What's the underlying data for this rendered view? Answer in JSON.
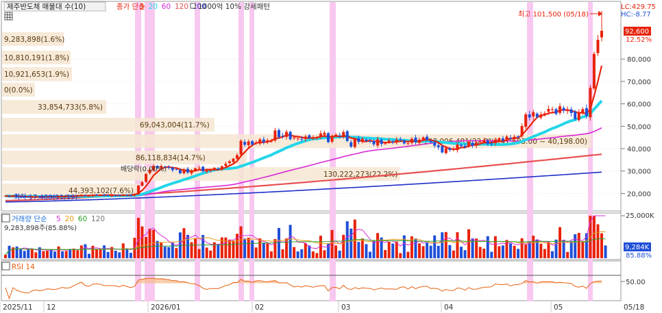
{
  "header": {
    "stock_name": "제주반도체 매물대 수(10)",
    "ma_title": "종가 단순",
    "ma_periods": [
      "5",
      "20",
      "60",
      "120",
      "200"
    ],
    "ma_colors": [
      "#e8220a",
      "#22d6e8",
      "#d82ad8",
      "#e85050",
      "#1f2fc8"
    ],
    "filter_text": "1000억 10% 강세패턴"
  },
  "lc_hc": {
    "lc": "LC:429.75",
    "hc": "HC:-8.77"
  },
  "price_axis": {
    "ticks": [
      "80,000",
      "70,000",
      "60,000",
      "50,000",
      "40,000",
      "30,000",
      "20,000"
    ],
    "current_price": "92,600",
    "current_change": "12.52%"
  },
  "annotations": {
    "high": "최고 101,500 (05/18)",
    "low": "최저 17,480(11/19)",
    "dividend": "배당락(0.00%)"
  },
  "volume_profile": [
    {
      "label": "9,283,898(1.6%)"
    },
    {
      "label": "10,810,191(1.8%)"
    },
    {
      "label": "10,921,653(1.9%)"
    },
    {
      "label": "0(0.0%)"
    },
    {
      "label": "33,854,733(5.8%)"
    },
    {
      "label": "69,043,004(11.7%)"
    },
    {
      "label": "193,006,481(32.8%)(47,603.00 ~ 40,198.00)"
    },
    {
      "label": "86,118,834(14.7%)"
    },
    {
      "label": "130,222,273(22.2%)"
    },
    {
      "label": "44,393,102(7.6%)"
    }
  ],
  "volume_panel": {
    "title": "거래량 단순",
    "periods": [
      "5",
      "20",
      "60",
      "120"
    ],
    "colors": [
      "#d82ad8",
      "#e89a10",
      "#2aa02a",
      "#777777"
    ],
    "subtitle": "9,283,898주(85.88%)",
    "axis_tick": "25,000K",
    "current_value": "9,284K",
    "current_pct": "85.88%"
  },
  "rsi_panel": {
    "title": "RSI 14",
    "axis_tick": "50.00"
  },
  "x_axis": {
    "labels": [
      "2025/11",
      "12",
      "2026/01",
      "02",
      "03",
      "04",
      "05",
      "05/18"
    ]
  },
  "chart_data": {
    "type": "candlestick",
    "x_range": [
      "2025/11",
      "2026/05/18"
    ],
    "y_range": [
      15000,
      103000
    ],
    "highlight_color": "#f8c8f0",
    "closes": [
      18900,
      18600,
      18900,
      18700,
      18550,
      18400,
      18300,
      18500,
      18600,
      18400,
      18500,
      18700,
      18600,
      18500,
      18700,
      18650,
      18800,
      18700,
      18900,
      19100,
      19400,
      18950,
      18900,
      19200,
      19400,
      19450,
      19100,
      19000,
      19200,
      19100,
      19000,
      19400,
      19200,
      19100,
      19800,
      23500,
      25100,
      28700,
      30600,
      32300,
      31300,
      32300,
      31900,
      31400,
      30400,
      30700,
      29000,
      30700,
      29300,
      30200,
      31200,
      31500,
      29900,
      30200,
      30400,
      31400,
      30800,
      32100,
      33200,
      34300,
      35500,
      37100,
      43500,
      41700,
      43200,
      41800,
      42600,
      44100,
      42900,
      43700,
      43800,
      48100,
      45200,
      45600,
      47500,
      44200,
      44900,
      44500,
      44200,
      45400,
      44800,
      44900,
      45000,
      46800,
      47100,
      42900,
      45300,
      46200,
      45700,
      47400,
      43400,
      40900,
      44400,
      43000,
      44400,
      43400,
      43100,
      41900,
      44100,
      42100,
      42300,
      43600,
      42800,
      44000,
      44100,
      42300,
      42400,
      44400,
      42900,
      44000,
      45000,
      43900,
      43000,
      41300,
      40600,
      38300,
      40200,
      39400,
      39800,
      41800,
      41100,
      40600,
      43000,
      41300,
      42600,
      43200,
      43800,
      42100,
      42000,
      44000,
      44600,
      43700,
      45400,
      44400,
      45300,
      45100,
      50100,
      55300,
      53900,
      56300,
      54100,
      55200,
      55800,
      57700,
      57600,
      55500,
      58900,
      57000,
      57300,
      55900,
      53200,
      56200,
      57600,
      54600,
      67100,
      82300,
      88600,
      92600
    ],
    "avg_price": 45000,
    "current_price": 92600
  }
}
